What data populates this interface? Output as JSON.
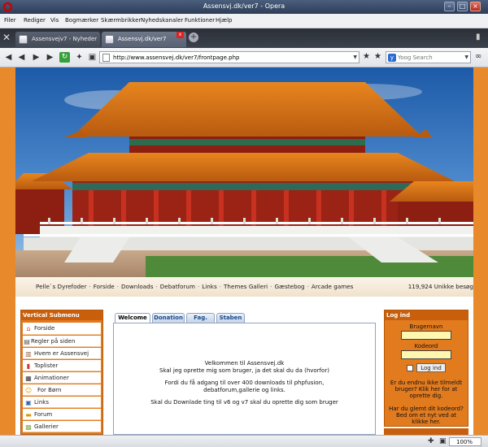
{
  "window": {
    "title": "Assensvj.dk/ver7 - Opera"
  },
  "menubar": {
    "items": [
      "Filer",
      "Rediger",
      "Vis",
      "Bogmærker",
      "Skærmbrikker",
      "Nyhedskanaler",
      "Funktioner",
      "Hjælp"
    ]
  },
  "tabs": [
    {
      "label": "Assensvejv7 - Nyheder",
      "active": false
    },
    {
      "label": "Assensvj.dk/ver7",
      "active": true
    }
  ],
  "address": {
    "url": "http://www.assensvej.dk/ver7/frontpage.php"
  },
  "search": {
    "placeholder": "Yoog Search"
  },
  "site": {
    "nav_links": [
      "Pelle`s Dyrefoder",
      "Forside",
      "Downloads",
      "Debatforum",
      "Links",
      "Themes Galleri",
      "Gæstebog",
      "Arcade games"
    ],
    "nav_separator": "·",
    "visitor_count": "119,924 Unikke besøg",
    "submenu": {
      "title": "Vertical Submenu",
      "items": [
        {
          "label": "Forside",
          "icon": "home-icon"
        },
        {
          "label": "Regler på siden",
          "icon": "document-icon"
        },
        {
          "label": "Hvem er Assensvej",
          "icon": "book-icon"
        },
        {
          "label": "Toplister",
          "icon": "chart-icon"
        },
        {
          "label": "Animationer",
          "icon": "film-icon"
        },
        {
          "label": "For Børn",
          "icon": "smiley-icon"
        },
        {
          "label": "Links",
          "icon": "link-icon"
        },
        {
          "label": "Forum",
          "icon": "forum-icon"
        },
        {
          "label": "Gallerier",
          "icon": "gallery-icon"
        }
      ]
    },
    "content_tabs": [
      {
        "label": "Welcome",
        "active": true
      },
      {
        "label": "Donation",
        "active": false
      },
      {
        "label": "Fag.",
        "active": false
      },
      {
        "label": "Staben",
        "active": false
      }
    ],
    "welcome": {
      "lines": [
        "Velkommen til Assensvej.dk",
        "Skal jeg oprette mig som bruger, ja det skal du da (hvorfor)",
        "Fordi du få adgang til over 400 downloads til phpfusion,",
        "debatforum,gallerie og links.",
        "Skal du Downlade ting til v6 og v7 skal du oprette dig som bruger"
      ]
    },
    "login": {
      "title": "Log ind",
      "username_label": "Brugernavn",
      "password_label": "Kodeord",
      "button_label": "Log ind",
      "register_text": "Er du endnu ikke tilmeldt bruger? Klik her for at oprette dig.",
      "forgot_text": "Har du glemt dit kodeord? Bed om et nyt ved at klikke her."
    }
  },
  "statusbar": {
    "zoom": "100%"
  },
  "colors": {
    "page_background": "#e8892b",
    "panel_orange": "#e27a1e",
    "panel_header": "#c95f0c",
    "tab_blue": "#1c4a8c",
    "login_field": "#fff7b0"
  }
}
